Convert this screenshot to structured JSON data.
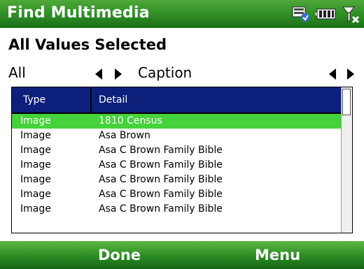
{
  "title_bar": {
    "title": "Find Multimedia",
    "icons": [
      "network-icon",
      "battery-icon",
      "signal-icon"
    ],
    "color": "#2f8f26"
  },
  "header": {
    "text": "All Values Selected"
  },
  "filter": {
    "field": "All",
    "value": "Caption"
  },
  "table": {
    "columns": [
      "Type",
      "Detail"
    ],
    "header_color": "#0c1f7a",
    "selected_color": "#45d23a",
    "rows": [
      {
        "type": "Image",
        "detail": "1810 Census",
        "selected": true
      },
      {
        "type": "Image",
        "detail": "Asa Brown",
        "selected": false
      },
      {
        "type": "Image",
        "detail": "Asa C Brown Family Bible",
        "selected": false
      },
      {
        "type": "Image",
        "detail": "Asa C Brown Family Bible",
        "selected": false
      },
      {
        "type": "Image",
        "detail": "Asa C Brown Family Bible",
        "selected": false
      },
      {
        "type": "Image",
        "detail": "Asa C Brown Family Bible",
        "selected": false
      },
      {
        "type": "Image",
        "detail": "Asa C Brown Family Bible",
        "selected": false
      }
    ]
  },
  "softkeys": {
    "left": "Done",
    "right": "Menu"
  }
}
